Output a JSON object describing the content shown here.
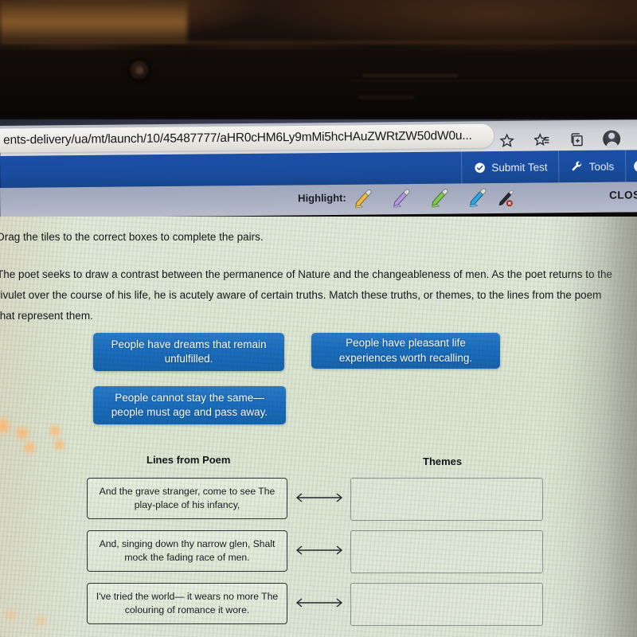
{
  "window": {
    "minimize_label": "—",
    "maximize_label": "□"
  },
  "browser": {
    "url": "ents-delivery/ua/mt/launch/10/45487777/aHR0cHM6Ly9mMi5hcHAuZWRtZW50dW0u...",
    "icons": [
      {
        "name": "favorite-star-icon",
        "label": "Add this page to favorites"
      },
      {
        "name": "favorites-list-icon",
        "label": "Favorites"
      },
      {
        "name": "collections-icon",
        "label": "Collections"
      },
      {
        "name": "profile-avatar-icon",
        "label": "Profile"
      }
    ]
  },
  "navbar": {
    "submit_test_label": "Submit Test",
    "tools_label": "Tools",
    "info_label": "i"
  },
  "highlight_toolbar": {
    "label": "Highlight:",
    "pens": [
      {
        "name": "highlighter-yellow",
        "color": "#e8b84b"
      },
      {
        "name": "highlighter-purple",
        "color": "#b09ad8"
      },
      {
        "name": "highlighter-green",
        "color": "#7ec94a"
      },
      {
        "name": "highlighter-blue",
        "color": "#2fa8e0"
      }
    ],
    "eraser_name": "remove-highlight-icon",
    "close_label": "CLOSE"
  },
  "content": {
    "instruction": "Drag the tiles to the correct boxes to complete the pairs.",
    "passage": "The poet seeks to draw a contrast between the permanence of Nature and the changeableness of men. As the poet returns to the rivulet over the course of his life, he is acutely aware of certain truths. Match these truths, or themes, to the lines from the poem that represent them.",
    "tiles": [
      "People have dreams that remain unfulfilled.",
      "People have pleasant life experiences worth recalling.",
      "People cannot stay the same— people must age and pass away."
    ],
    "column_headers": {
      "left": "Lines from Poem",
      "right": "Themes"
    },
    "rows": [
      {
        "line": "And the grave stranger, come to see The play-place of his infancy,",
        "theme": ""
      },
      {
        "line": "And, singing down thy narrow glen, Shalt mock the fading race of men.",
        "theme": ""
      },
      {
        "line": "I've tried the world— it wears no more The colouring of romance it wore.",
        "theme": ""
      }
    ]
  },
  "colors": {
    "nav_blue": "#1a4da1",
    "tile_blue": "#1b6ebe",
    "toolbar_gray": "#a7aec2",
    "page_background": "#dfe5d6"
  }
}
